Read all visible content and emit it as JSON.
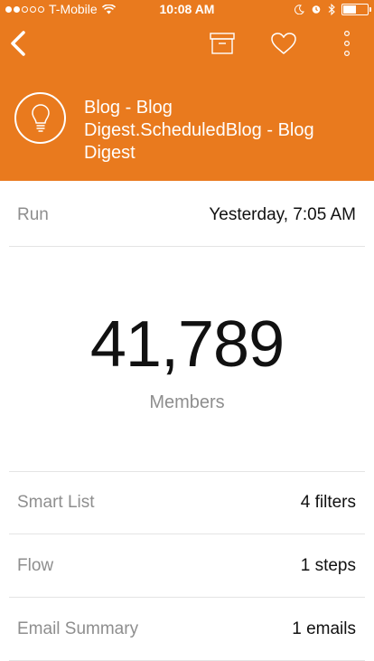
{
  "status_bar": {
    "carrier": "T-Mobile",
    "time": "10:08 AM"
  },
  "header": {
    "title": "Blog - Blog Digest.ScheduledBlog - Blog Digest",
    "icons": {
      "back": "back-chevron-icon",
      "archive": "archive-box-icon",
      "favorite": "heart-icon",
      "more": "more-vertical-icon",
      "program": "lightbulb-icon"
    },
    "color": "#E97A1E"
  },
  "run": {
    "label": "Run",
    "value": "Yesterday, 7:05 AM"
  },
  "members": {
    "count": "41,789",
    "label": "Members"
  },
  "details": [
    {
      "label": "Smart List",
      "value": "4 filters"
    },
    {
      "label": "Flow",
      "value": "1 steps"
    },
    {
      "label": "Email Summary",
      "value": "1 emails"
    }
  ]
}
